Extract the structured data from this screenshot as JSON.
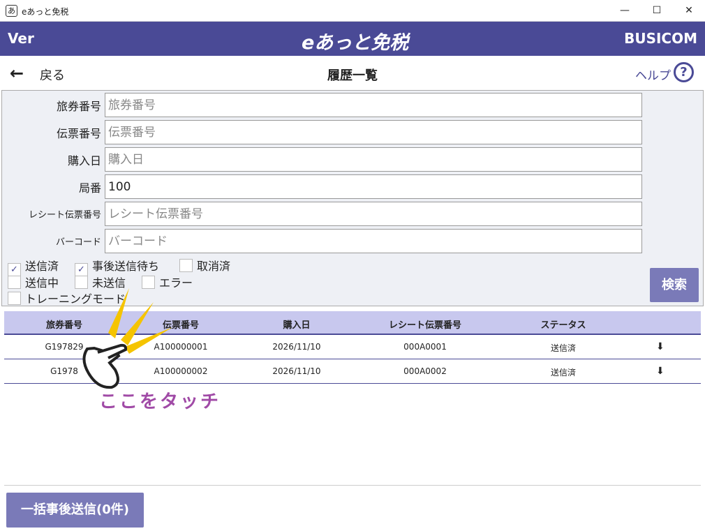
{
  "window": {
    "title": "eあっと免税",
    "icon": "あ",
    "minimize": "—",
    "maximize": "☐",
    "close": "✕"
  },
  "header": {
    "version": "Ver",
    "brand": "eあっと免税",
    "company": "BUSICOM"
  },
  "nav": {
    "back_label": "戻る",
    "title": "履歴一覧",
    "help_label": "ヘルプ",
    "help_icon": "?"
  },
  "form": {
    "fields": [
      {
        "label": "旅券番号",
        "placeholder": "旅券番号",
        "value": ""
      },
      {
        "label": "伝票番号",
        "placeholder": "伝票番号",
        "value": ""
      },
      {
        "label": "購入日",
        "placeholder": "購入日",
        "value": ""
      },
      {
        "label": "局番",
        "placeholder": "",
        "value": "100"
      },
      {
        "label": "レシート伝票番号",
        "placeholder": "レシート伝票番号",
        "value": ""
      },
      {
        "label": "バーコード",
        "placeholder": "バーコード",
        "value": ""
      }
    ],
    "checkboxes": [
      {
        "label": "送信済",
        "checked": true,
        "mark": "✓"
      },
      {
        "label": "事後送信待ち",
        "checked": true,
        "mark": "✓"
      },
      {
        "label": "取消済",
        "checked": false,
        "mark": ""
      },
      {
        "label": "送信中",
        "checked": false,
        "mark": ""
      },
      {
        "label": "未送信",
        "checked": false,
        "mark": ""
      },
      {
        "label": "エラー",
        "checked": false,
        "mark": ""
      },
      {
        "label": "トレーニングモード",
        "checked": false,
        "mark": ""
      }
    ],
    "search_label": "検索"
  },
  "table": {
    "columns": [
      "旅券番号",
      "伝票番号",
      "購入日",
      "レシート伝票番号",
      "ステータス"
    ],
    "rows": [
      {
        "passport": "G197829",
        "slip": "A100000001",
        "date": "2026/11/10",
        "receipt": "000A0001",
        "status": "送信済",
        "icon": "⬇"
      },
      {
        "passport": "G1978",
        "slip": "A100000002",
        "date": "2026/11/10",
        "receipt": "000A0002",
        "status": "送信済",
        "icon": "⬇"
      }
    ]
  },
  "annotation": {
    "text": "ここをタッチ"
  },
  "footer": {
    "bulk_send_label": "一括事後送信(0件)"
  },
  "colors": {
    "header": "#4a4a96",
    "button": "#7a7ab8",
    "table_head": "#c8c8ee",
    "annotation": "#a04aa6",
    "pointer": "#f5c400"
  }
}
